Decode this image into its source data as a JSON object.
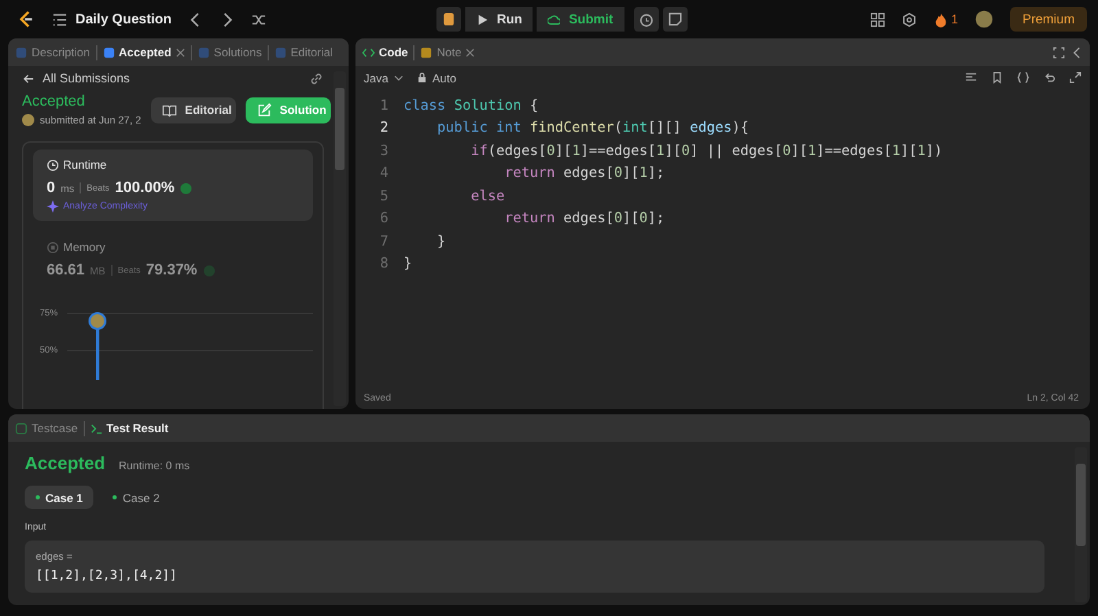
{
  "topbar": {
    "title": "Daily Question",
    "run": "Run",
    "submit": "Submit",
    "streak": "1",
    "premium": "Premium"
  },
  "left_panel": {
    "tabs": [
      {
        "label": "Description",
        "selected": false,
        "closable": false
      },
      {
        "label": "Accepted",
        "selected": true,
        "closable": true
      },
      {
        "label": "Solutions",
        "selected": false,
        "closable": false
      },
      {
        "label": "Editorial",
        "selected": false,
        "closable": false
      }
    ],
    "back_link": "All Submissions",
    "status": "Accepted",
    "submitted": "submitted at Jun 27, 2",
    "editorial_button": "Editorial",
    "solution_button": "Solution",
    "runtime": {
      "title": "Runtime",
      "value": "0",
      "unit": "ms",
      "beats_label": "Beats",
      "beats": "100.00%",
      "analyze": "Analyze Complexity"
    },
    "memory": {
      "title": "Memory",
      "value": "66.61",
      "unit": "MB",
      "beats_label": "Beats",
      "beats": "79.37%"
    },
    "chart_ticks": [
      "75%",
      "50%"
    ]
  },
  "editor": {
    "tabs": [
      {
        "label": "Code",
        "selected": true,
        "closable": false
      },
      {
        "label": "Note",
        "selected": false,
        "closable": true
      }
    ],
    "language": "Java",
    "mode": "Auto",
    "lines": [
      {
        "number": "1",
        "active": false,
        "tokens": [
          {
            "text": "class ",
            "kind": "kw"
          },
          {
            "text": "Solution ",
            "kind": "type"
          },
          {
            "text": "{",
            "kind": "plain"
          }
        ]
      },
      {
        "number": "2",
        "active": true,
        "tokens": [
          {
            "text": "    public int ",
            "kind": "kw"
          },
          {
            "text": "findCenter",
            "kind": "fn"
          },
          {
            "text": "(",
            "kind": "plain"
          },
          {
            "text": "int",
            "kind": "type"
          },
          {
            "text": "[][] ",
            "kind": "plain"
          },
          {
            "text": "edges",
            "kind": "var"
          },
          {
            "text": "){",
            "kind": "plain"
          }
        ]
      },
      {
        "number": "3",
        "active": false,
        "tokens": [
          {
            "text": "        if",
            "kind": "ctrl"
          },
          {
            "text": "(edges[",
            "kind": "plain"
          },
          {
            "text": "0",
            "kind": "num"
          },
          {
            "text": "][",
            "kind": "plain"
          },
          {
            "text": "1",
            "kind": "num"
          },
          {
            "text": "]==edges[",
            "kind": "plain"
          },
          {
            "text": "1",
            "kind": "num"
          },
          {
            "text": "][",
            "kind": "plain"
          },
          {
            "text": "0",
            "kind": "num"
          },
          {
            "text": "] || edges[",
            "kind": "plain"
          },
          {
            "text": "0",
            "kind": "num"
          },
          {
            "text": "][",
            "kind": "plain"
          },
          {
            "text": "1",
            "kind": "num"
          },
          {
            "text": "]==edges[",
            "kind": "plain"
          },
          {
            "text": "1",
            "kind": "num"
          },
          {
            "text": "][",
            "kind": "plain"
          },
          {
            "text": "1",
            "kind": "num"
          },
          {
            "text": "])",
            "kind": "plain"
          }
        ]
      },
      {
        "number": "4",
        "active": false,
        "tokens": [
          {
            "text": "            return",
            "kind": "ctrl"
          },
          {
            "text": " edges[",
            "kind": "plain"
          },
          {
            "text": "0",
            "kind": "num"
          },
          {
            "text": "][",
            "kind": "plain"
          },
          {
            "text": "1",
            "kind": "num"
          },
          {
            "text": "];",
            "kind": "plain"
          }
        ]
      },
      {
        "number": "5",
        "active": false,
        "tokens": [
          {
            "text": "        else",
            "kind": "ctrl"
          }
        ]
      },
      {
        "number": "6",
        "active": false,
        "tokens": [
          {
            "text": "            return",
            "kind": "ctrl"
          },
          {
            "text": " edges[",
            "kind": "plain"
          },
          {
            "text": "0",
            "kind": "num"
          },
          {
            "text": "][",
            "kind": "plain"
          },
          {
            "text": "0",
            "kind": "num"
          },
          {
            "text": "];",
            "kind": "plain"
          }
        ]
      },
      {
        "number": "7",
        "active": false,
        "tokens": [
          {
            "text": "    }",
            "kind": "plain"
          }
        ]
      },
      {
        "number": "8",
        "active": false,
        "tokens": [
          {
            "text": "}",
            "kind": "plain"
          }
        ]
      }
    ],
    "status": "Saved",
    "cursor": "Ln 2, Col 42"
  },
  "console": {
    "tabs": [
      {
        "label": "Testcase",
        "selected": false
      },
      {
        "label": "Test Result",
        "selected": true
      }
    ],
    "result": "Accepted",
    "runtime": "Runtime: 0 ms",
    "cases": [
      {
        "label": "Case 1",
        "selected": true
      },
      {
        "label": "Case 2",
        "selected": false
      }
    ],
    "input_label": "Input",
    "param": "edges =",
    "value": "[[1,2],[2,3],[4,2]]"
  }
}
